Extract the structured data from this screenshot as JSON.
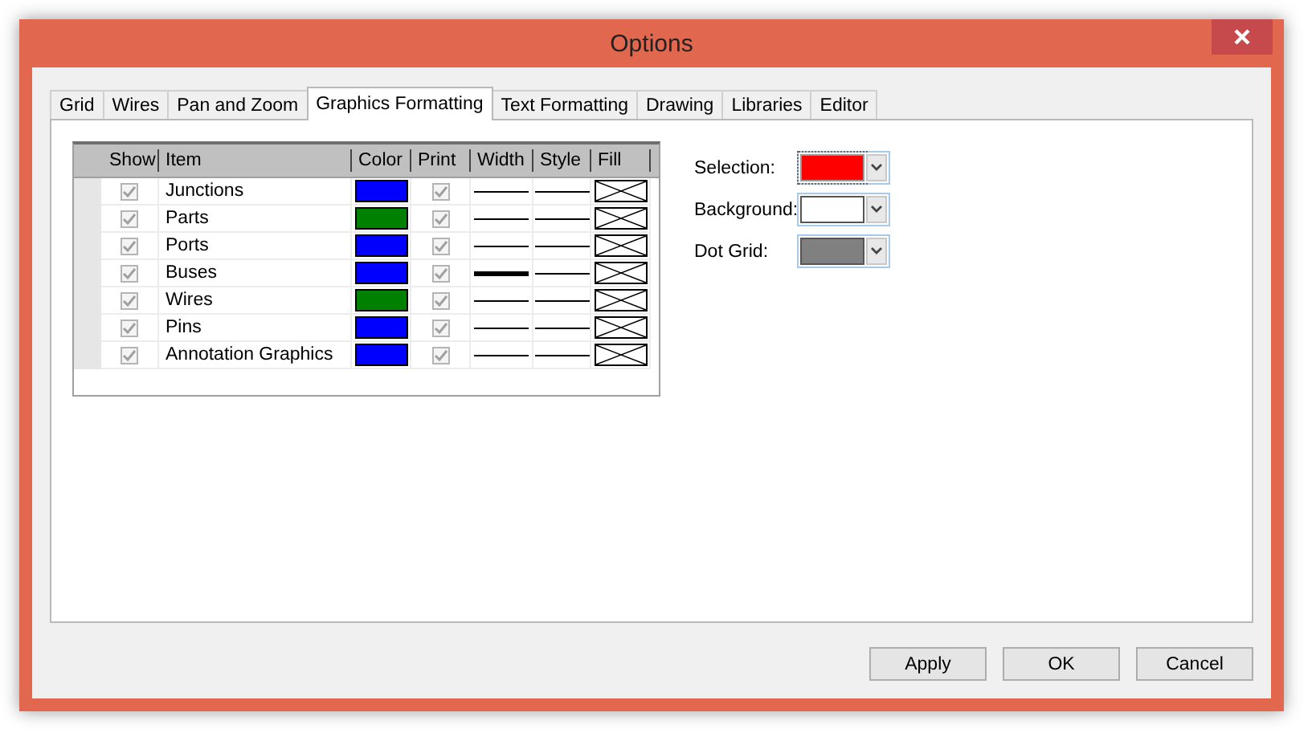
{
  "window": {
    "title": "Options"
  },
  "tabs": [
    {
      "label": "Grid",
      "selected": false
    },
    {
      "label": "Wires",
      "selected": false
    },
    {
      "label": "Pan and Zoom",
      "selected": false
    },
    {
      "label": "Graphics Formatting",
      "selected": true
    },
    {
      "label": "Text Formatting",
      "selected": false
    },
    {
      "label": "Drawing",
      "selected": false
    },
    {
      "label": "Libraries",
      "selected": false
    },
    {
      "label": "Editor",
      "selected": false
    }
  ],
  "table": {
    "columns": [
      "Show",
      "Item",
      "Color",
      "Print",
      "Width",
      "Style",
      "Fill"
    ],
    "rows": [
      {
        "show": true,
        "item": "Junctions",
        "color": "#0000ff",
        "print": true,
        "thick": false
      },
      {
        "show": true,
        "item": "Parts",
        "color": "#008000",
        "print": true,
        "thick": false
      },
      {
        "show": true,
        "item": "Ports",
        "color": "#0000ff",
        "print": true,
        "thick": false
      },
      {
        "show": true,
        "item": "Buses",
        "color": "#0000ff",
        "print": true,
        "thick": true
      },
      {
        "show": true,
        "item": "Wires",
        "color": "#008000",
        "print": true,
        "thick": false
      },
      {
        "show": true,
        "item": "Pins",
        "color": "#0000ff",
        "print": true,
        "thick": false
      },
      {
        "show": true,
        "item": "Annotation Graphics",
        "color": "#0000ff",
        "print": true,
        "thick": false
      }
    ]
  },
  "color_pickers": [
    {
      "label": "Selection:",
      "color": "#ff0000",
      "selected": true
    },
    {
      "label": "Background:",
      "color": "#ffffff",
      "selected": false
    },
    {
      "label": "Dot Grid:",
      "color": "#808080",
      "selected": false
    }
  ],
  "buttons": [
    "Apply",
    "OK",
    "Cancel"
  ]
}
